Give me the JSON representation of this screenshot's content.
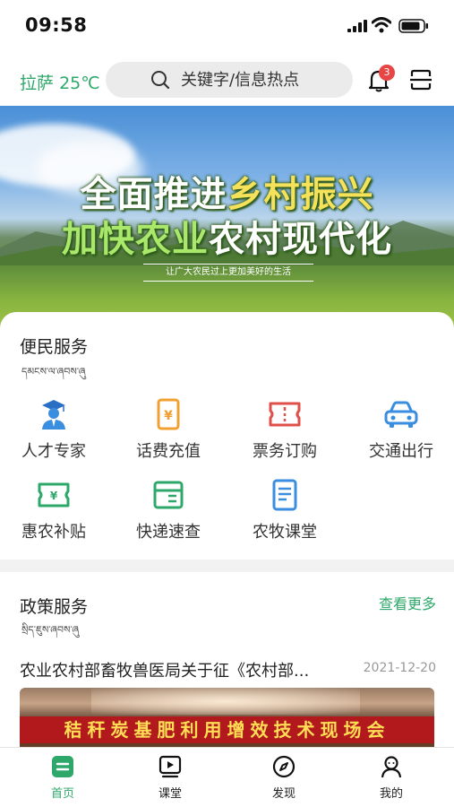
{
  "status_bar": {
    "time": "09:58"
  },
  "header": {
    "city": "拉萨",
    "temperature": "25℃",
    "search_placeholder": "关键字/信息热点",
    "notification_count": "3"
  },
  "banner": {
    "line1_a": "全面推进",
    "line1_b": "乡村振兴",
    "line2_a": "加快农业",
    "line2_b": "农村现代化",
    "slogan": "让广大农民过上更加美好的生活"
  },
  "services": {
    "title": "便民服务",
    "subtitle": "དམངས་ལ་ཞབས་ཞུ",
    "items": [
      {
        "label": "人才专家",
        "icon": "expert-icon"
      },
      {
        "label": "话费充值",
        "icon": "phone-bill-icon"
      },
      {
        "label": "票务订购",
        "icon": "ticket-icon"
      },
      {
        "label": "交通出行",
        "icon": "car-icon"
      },
      {
        "label": "惠农补贴",
        "icon": "subsidy-icon"
      },
      {
        "label": "快递速查",
        "icon": "package-icon"
      },
      {
        "label": "农牧课堂",
        "icon": "book-icon"
      }
    ]
  },
  "policy": {
    "title": "政策服务",
    "subtitle": "སྲིད་ཇུས་ཞབས་ཞུ",
    "more": "查看更多",
    "news": [
      {
        "title": "农业农村部畜牧兽医局关于征《农村部...",
        "date": "2021-12-20",
        "image_caption": "秸秆炭基肥利用增效技术现场会"
      }
    ]
  },
  "tabbar": {
    "items": [
      {
        "label": "首页",
        "icon": "home-icon",
        "active": true
      },
      {
        "label": "课堂",
        "icon": "video-icon",
        "active": false
      },
      {
        "label": "发现",
        "icon": "compass-icon",
        "active": false
      },
      {
        "label": "我的",
        "icon": "profile-icon",
        "active": false
      }
    ]
  },
  "colors": {
    "accent": "#2ea86a",
    "badge": "#e84545",
    "icon_orange": "#f0a030",
    "icon_red": "#e0504a",
    "icon_blue": "#3a8ee0"
  }
}
